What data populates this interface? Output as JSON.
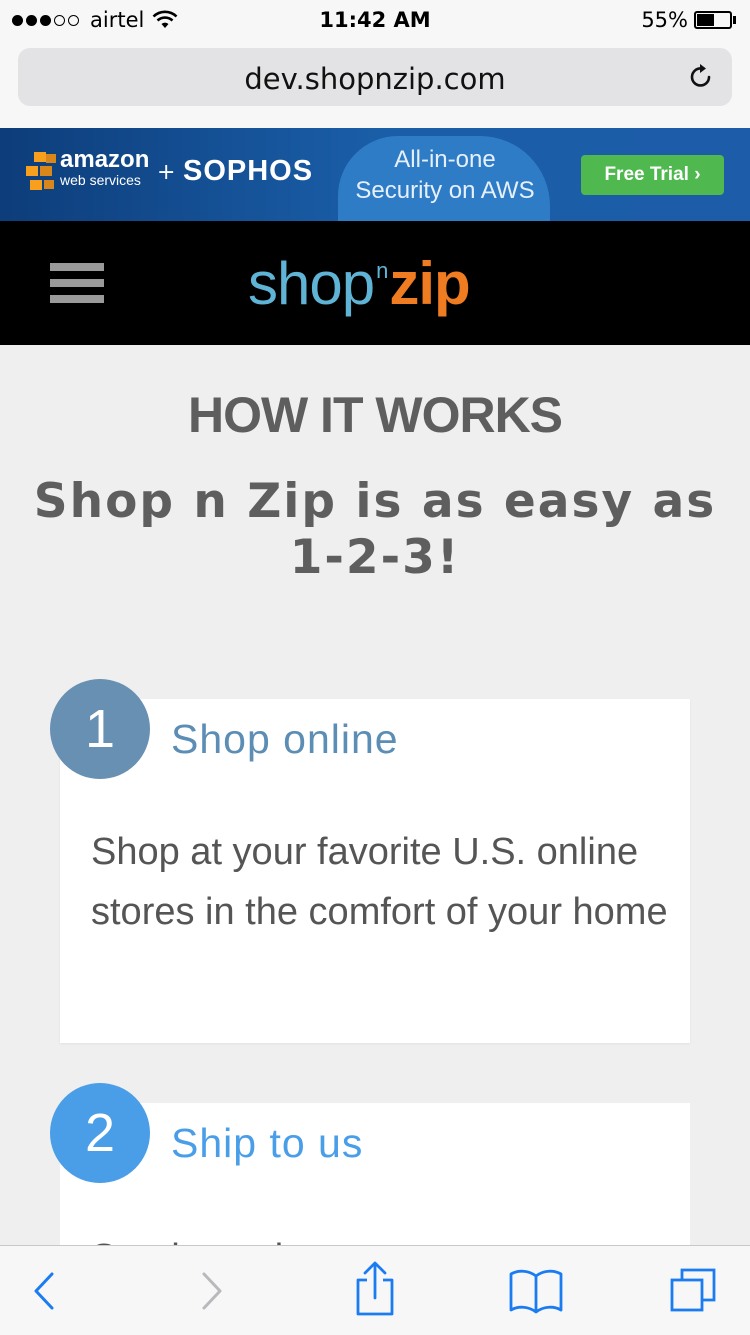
{
  "status": {
    "carrier": "airtel",
    "time": "11:42 AM",
    "battery": "55%",
    "battery_level": 0.55
  },
  "browser": {
    "url": "dev.shopnzip.com"
  },
  "ad": {
    "aws_line1": "amazon",
    "aws_line2": "web services",
    "plus": "+",
    "partner": "SOPHOS",
    "tagline_line1": "All-in-one",
    "tagline_line2": "Security on AWS",
    "cta": "Free Trial ›"
  },
  "site": {
    "logo_shop": "shop",
    "logo_n": "n",
    "logo_zip": "zip"
  },
  "content": {
    "heading": "HOW IT WORKS",
    "subtitle": "Shop n Zip is as easy as 1-2-3!",
    "steps": [
      {
        "number": "1",
        "title": "Shop online",
        "description": "Shop at your favorite U.S. online stores in the comfort of your home"
      },
      {
        "number": "2",
        "title": "Ship to us",
        "description": "Send your items to us"
      }
    ]
  },
  "colors": {
    "step1": "#6790b2",
    "step2": "#4a9ee8",
    "logo_blue": "#5fb4d6",
    "logo_orange": "#f07c22",
    "ios_blue": "#1b7cf2"
  }
}
